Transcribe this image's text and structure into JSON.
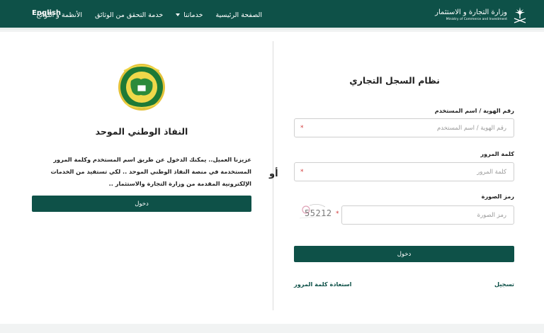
{
  "header": {
    "brand_ar": "وزارة التجارة و الاستثمار",
    "brand_en": "Ministry of Commerce and Investment",
    "nav": [
      {
        "label": "الصفحة الرئيسية"
      },
      {
        "label": "خدماتنا"
      },
      {
        "label": "خدمة التحقق من الوثائق"
      },
      {
        "label": "الأنظمة و اللوائح"
      }
    ],
    "lang_label": "English"
  },
  "left": {
    "title": "النفاذ الوطني الموحد",
    "description": "عزيزنا العميل.. يمكنك الدخول عن طريق اسم المستخدم وكلمة المرور المستخدمة في منصة النفاذ الوطني الموحد .. لكي تستفيد من الخدمات الإلكترونية المقدمة من وزارة التجارة والاستثمار ..",
    "login_label": "دخول"
  },
  "separator": "أو",
  "right": {
    "title": "نظام السجل التجاري",
    "id_label": "رقم الهوية / اسم المستخدم",
    "id_placeholder": "رقم الهوية / اسم المستخدم",
    "password_label": "كلمة المرور",
    "password_placeholder": "كلمة المرور",
    "captcha_label": "رمز الصورة",
    "captcha_placeholder": "رمز الصورة",
    "captcha_value": "55212",
    "required_mark": "*",
    "login_label": "دخول",
    "register_label": "تسجيل",
    "recover_label": "استعادة كلمة المرور"
  },
  "colors": {
    "primary": "#0e5148",
    "required": "#d23a3a"
  },
  "icons": {
    "brand_emblem": "palm-swords-emblem",
    "seal": "national-seal"
  }
}
